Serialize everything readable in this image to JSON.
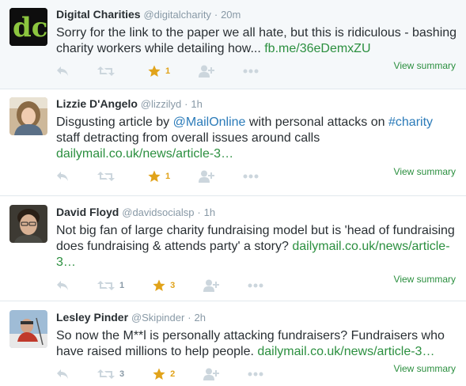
{
  "tweets": [
    {
      "name": "Digital Charities",
      "handle": "@digitalcharity",
      "time": "20m",
      "text_before": "Sorry for the link to the paper we all hate, but this is ridiculous - bashing charity workers while detailing how... ",
      "url": "fb.me/36eDemxZU",
      "retweets": "",
      "favorites": "1",
      "view_summary": "View summary"
    },
    {
      "name": "Lizzie D'Angelo",
      "handle": "@lizzilyd",
      "time": "1h",
      "text_part1": "Disgusting article by ",
      "mention": "@MailOnline",
      "text_part2": " with personal attacks on ",
      "hashtag": "#charity",
      "text_part3": " staff detracting from overall issues around calls",
      "url": "dailymail.co.uk/news/article-3…",
      "retweets": "",
      "favorites": "1",
      "view_summary": "View summary"
    },
    {
      "name": "David Floyd",
      "handle": "@davidsocialsp",
      "time": "1h",
      "text_before": "Not big fan of large charity fundraising model but is 'head of fundraising does fundraising & attends party' a story? ",
      "url": "dailymail.co.uk/news/article-3…",
      "retweets": "1",
      "favorites": "3",
      "view_summary": "View summary"
    },
    {
      "name": "Lesley Pinder",
      "handle": "@Skipinder",
      "time": "2h",
      "text_before": "So now the M**l is personally attacking fundraisers? Fundraisers who have raised millions to help people. ",
      "url": "dailymail.co.uk/news/article-3…",
      "retweets": "3",
      "favorites": "2",
      "view_summary": "View summary"
    }
  ],
  "separator": "·",
  "colors": {
    "url": "#2b8f3f",
    "mention": "#2b7bb9",
    "favorite": "#e1a31a",
    "icon": "#ccd6dd"
  }
}
